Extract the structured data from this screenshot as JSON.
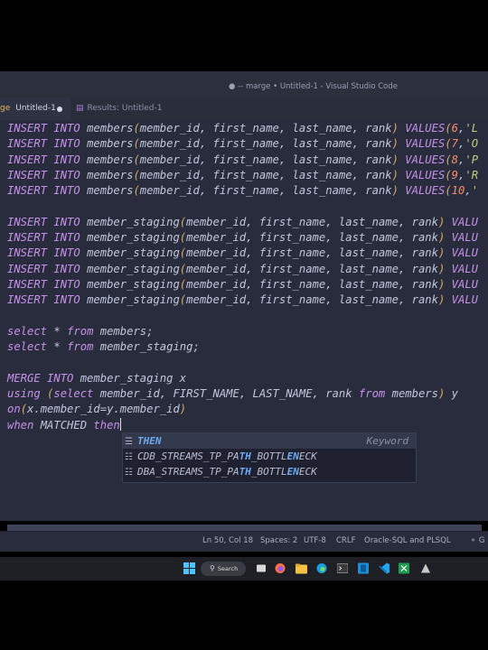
{
  "window": {
    "title": "● -- marge • Untitled-1 - Visual Studio Code"
  },
  "tabs": {
    "active": {
      "prefix": "ge",
      "label": "Untitled-1"
    },
    "results": {
      "label": "Results: Untitled-1"
    }
  },
  "editor": {
    "lines": [
      [
        [
          "kw",
          "INSERT INTO "
        ],
        [
          "tx",
          "members"
        ],
        [
          "pn",
          "("
        ],
        [
          "tx",
          "member_id, first_name, last_name, rank"
        ],
        [
          "pn",
          ") "
        ],
        [
          "kw",
          "VALUES"
        ],
        [
          "pn",
          "("
        ],
        [
          "num",
          "6"
        ],
        [
          "tx",
          ","
        ],
        [
          "str",
          "'L"
        ]
      ],
      [
        [
          "kw",
          "INSERT INTO "
        ],
        [
          "tx",
          "members"
        ],
        [
          "pn",
          "("
        ],
        [
          "tx",
          "member_id, first_name, last_name, rank"
        ],
        [
          "pn",
          ") "
        ],
        [
          "kw",
          "VALUES"
        ],
        [
          "pn",
          "("
        ],
        [
          "num",
          "7"
        ],
        [
          "tx",
          ","
        ],
        [
          "str",
          "'O"
        ]
      ],
      [
        [
          "kw",
          "INSERT INTO "
        ],
        [
          "tx",
          "members"
        ],
        [
          "pn",
          "("
        ],
        [
          "tx",
          "member_id, first_name, last_name, rank"
        ],
        [
          "pn",
          ") "
        ],
        [
          "kw",
          "VALUES"
        ],
        [
          "pn",
          "("
        ],
        [
          "num",
          "8"
        ],
        [
          "tx",
          ","
        ],
        [
          "str",
          "'P"
        ]
      ],
      [
        [
          "kw",
          "INSERT INTO "
        ],
        [
          "tx",
          "members"
        ],
        [
          "pn",
          "("
        ],
        [
          "tx",
          "member_id, first_name, last_name, rank"
        ],
        [
          "pn",
          ") "
        ],
        [
          "kw",
          "VALUES"
        ],
        [
          "pn",
          "("
        ],
        [
          "num",
          "9"
        ],
        [
          "tx",
          ","
        ],
        [
          "str",
          "'R"
        ]
      ],
      [
        [
          "kw",
          "INSERT INTO "
        ],
        [
          "tx",
          "members"
        ],
        [
          "pn",
          "("
        ],
        [
          "tx",
          "member_id, first_name, last_name, rank"
        ],
        [
          "pn",
          ") "
        ],
        [
          "kw",
          "VALUES"
        ],
        [
          "pn",
          "("
        ],
        [
          "num",
          "10"
        ],
        [
          "tx",
          ","
        ],
        [
          "str",
          "'"
        ]
      ],
      [],
      [
        [
          "kw",
          "INSERT INTO "
        ],
        [
          "tx",
          "member_staging"
        ],
        [
          "pn",
          "("
        ],
        [
          "tx",
          "member_id, first_name, last_name, rank"
        ],
        [
          "pn",
          ") "
        ],
        [
          "kw",
          "VALU"
        ]
      ],
      [
        [
          "kw",
          "INSERT INTO "
        ],
        [
          "tx",
          "member_staging"
        ],
        [
          "pn",
          "("
        ],
        [
          "tx",
          "member_id, first_name, last_name, rank"
        ],
        [
          "pn",
          ") "
        ],
        [
          "kw",
          "VALU"
        ]
      ],
      [
        [
          "kw",
          "INSERT INTO "
        ],
        [
          "tx",
          "member_staging"
        ],
        [
          "pn",
          "("
        ],
        [
          "tx",
          "member_id, first_name, last_name, rank"
        ],
        [
          "pn",
          ") "
        ],
        [
          "kw",
          "VALU"
        ]
      ],
      [
        [
          "kw",
          "INSERT INTO "
        ],
        [
          "tx",
          "member_staging"
        ],
        [
          "pn",
          "("
        ],
        [
          "tx",
          "member_id, first_name, last_name, rank"
        ],
        [
          "pn",
          ") "
        ],
        [
          "kw",
          "VALU"
        ]
      ],
      [
        [
          "kw",
          "INSERT INTO "
        ],
        [
          "tx",
          "member_staging"
        ],
        [
          "pn",
          "("
        ],
        [
          "tx",
          "member_id, first_name, last_name, rank"
        ],
        [
          "pn",
          ") "
        ],
        [
          "kw",
          "VALU"
        ]
      ],
      [
        [
          "kw",
          "INSERT INTO "
        ],
        [
          "tx",
          "member_staging"
        ],
        [
          "pn",
          "("
        ],
        [
          "tx",
          "member_id, first_name, last_name, rank"
        ],
        [
          "pn",
          ") "
        ],
        [
          "kw",
          "VALU"
        ]
      ],
      [],
      [
        [
          "kw",
          "select "
        ],
        [
          "tx",
          "* "
        ],
        [
          "kw",
          "from "
        ],
        [
          "tx",
          "members;"
        ]
      ],
      [
        [
          "kw",
          "select "
        ],
        [
          "tx",
          "* "
        ],
        [
          "kw",
          "from "
        ],
        [
          "tx",
          "member_staging;"
        ]
      ],
      [],
      [
        [
          "kw",
          "MERGE INTO "
        ],
        [
          "tx",
          "member_staging x"
        ]
      ],
      [
        [
          "kw",
          "using "
        ],
        [
          "pn",
          "("
        ],
        [
          "kw",
          "select "
        ],
        [
          "tx",
          "member_id, FIRST_NAME, LAST_NAME, rank "
        ],
        [
          "kw",
          "from "
        ],
        [
          "tx",
          "members"
        ],
        [
          "pn",
          ")"
        ],
        [
          "tx",
          " y"
        ]
      ],
      [
        [
          "kw",
          "on"
        ],
        [
          "pn",
          "("
        ],
        [
          "tx",
          "x.member_id=y.member_id"
        ],
        [
          "pn",
          ")"
        ]
      ],
      [
        [
          "kw",
          "when "
        ],
        [
          "tx",
          "MATCHED "
        ],
        [
          "kw",
          "then"
        ]
      ]
    ]
  },
  "suggest": {
    "items": [
      {
        "icon": "keyword-icon",
        "label": [
          [
            "hl",
            "THEN"
          ]
        ],
        "kind": "Keyword"
      },
      {
        "icon": "file-icon",
        "label": [
          [
            "n",
            "CDB_STREAMS_TP_PA"
          ],
          [
            "hl",
            "TH"
          ],
          [
            "n",
            "_BOTTL"
          ],
          [
            "hl",
            "EN"
          ],
          [
            "n",
            "ECK"
          ]
        ],
        "kind": ""
      },
      {
        "icon": "file-icon",
        "label": [
          [
            "n",
            "DBA_STREAMS_TP_PA"
          ],
          [
            "hl",
            "TH"
          ],
          [
            "n",
            "_BOTTL"
          ],
          [
            "hl",
            "EN"
          ],
          [
            "n",
            "ECK"
          ]
        ],
        "kind": ""
      }
    ]
  },
  "status": {
    "position": "Ln 50, Col 18",
    "spaces": "Spaces: 2",
    "encoding": "UTF-8",
    "eol": "CRLF",
    "language": "Oracle-SQL and PLSQL",
    "extra": "G"
  },
  "taskbar": {
    "search_label": "Search"
  }
}
